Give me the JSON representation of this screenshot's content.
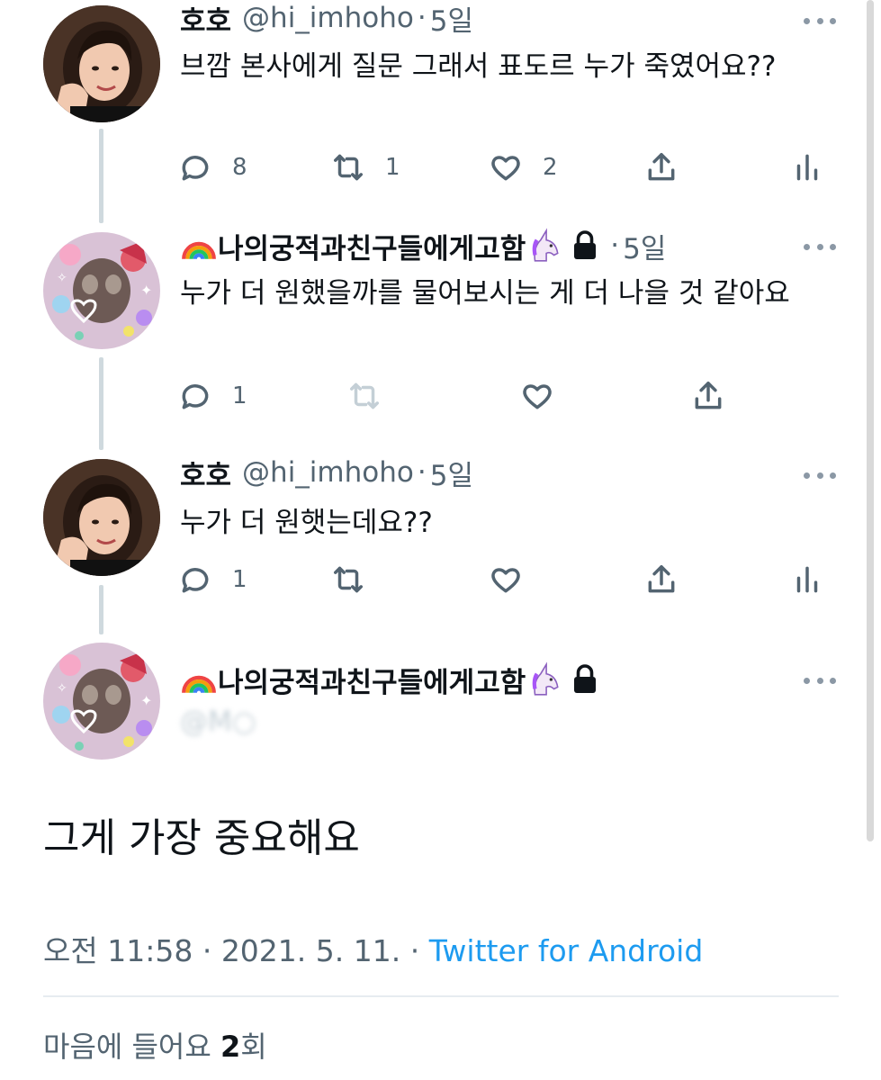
{
  "tweets": [
    {
      "name": "호호",
      "handle": "@hi_imhoho",
      "time": "5일",
      "text": "브깜 본사에게 질문 그래서 표도르 누가 죽였어요??",
      "replies": "8",
      "retweets": "1",
      "likes": "2",
      "avatar": "portrait-woman"
    },
    {
      "name": "나의궁적과친구들에게고함",
      "prefix_emoji": "rainbow",
      "suffix_emoji": "unicorn",
      "locked": true,
      "time": "5일",
      "text": "누가 더 원했을까를 물어보시는 게 더 나을 것 같아요",
      "replies": "1",
      "avatar": "sticker-collage"
    },
    {
      "name": "호호",
      "handle": "@hi_imhoho",
      "time": "5일",
      "text": "누가 더 원햇는데요??",
      "replies": "1",
      "avatar": "portrait-woman"
    }
  ],
  "main_tweet": {
    "name": "나의궁적과친구들에게고함",
    "prefix_emoji": "rainbow",
    "suffix_emoji": "unicorn",
    "locked": true,
    "text": "그게 가장 중요해요",
    "time": "오전 11:58",
    "date": "2021. 5. 11.",
    "separator": "·",
    "source": "Twitter for Android",
    "likes_label_prefix": "마음에 들어요",
    "likes_count": "2",
    "likes_label_suffix": "회"
  },
  "colors": {
    "text": "#0f1419",
    "secondary": "#536471",
    "link": "#1d9bf0",
    "thread_line": "#cfd9de"
  }
}
